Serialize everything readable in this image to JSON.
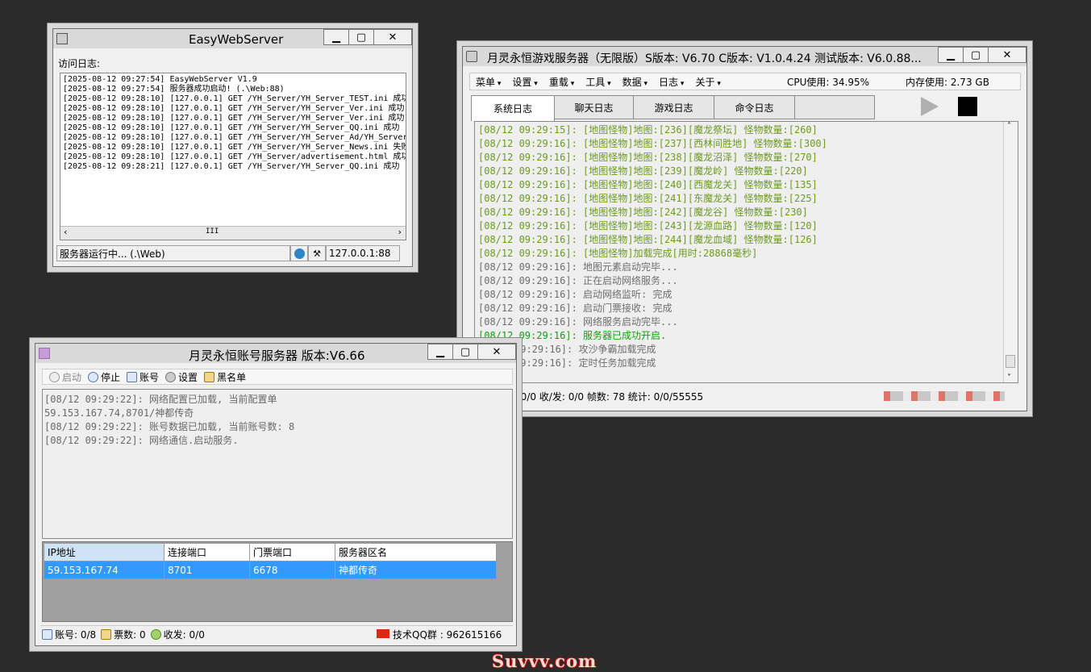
{
  "web": {
    "title": "EasyWebServer",
    "log_label": "访问日志:",
    "log": [
      "[2025-08-12 09:27:54] EasyWebServer V1.9",
      "[2025-08-12 09:27:54] 服务器成功启动! (.\\Web:88)",
      "[2025-08-12 09:28:10] [127.0.0.1] GET /YH_Server/YH_Server_TEST.ini 成功",
      "[2025-08-12 09:28:10] [127.0.0.1] GET /YH_Server/YH_Server_Ver.ini 成功",
      "[2025-08-12 09:28:10] [127.0.0.1] GET /YH_Server/YH_Server_Ver.ini 成功",
      "[2025-08-12 09:28:10] [127.0.0.1] GET /YH_Server/YH_Server_QQ.ini 成功",
      "[2025-08-12 09:28:10] [127.0.0.1] GET /YH_Server/YH_Server_Ad/YH_Server_",
      "[2025-08-12 09:28:10] [127.0.0.1] GET /YH_Server/YH_Server_News.ini 失败",
      "[2025-08-12 09:28:10] [127.0.0.1] GET /YH_Server/advertisement.html 成功",
      "[2025-08-12 09:28:21] [127.0.0.1] GET /YH_Server/YH_Server_QQ.ini 成功"
    ],
    "status": "服务器运行中... (.\\Web)",
    "address": "127.0.0.1:88",
    "scroll_mark": "III"
  },
  "game": {
    "title": "月灵永恒游戏服务器（无限版）S版本: V6.70 C版本: V1.0.4.24 测试版本: V6.0.88...",
    "menus": [
      "菜单",
      "设置",
      "重载",
      "工具",
      "数据",
      "日志",
      "关于"
    ],
    "cpu": "CPU使用: 34.95%",
    "mem": "内存使用: 2.73 GB",
    "tabs": [
      "系统日志",
      "聊天日志",
      "游戏日志",
      "命令日志"
    ],
    "log": [
      {
        "text": "[08/12 09:29:15]: [地图怪物]地图:[236][魔龙祭坛] 怪物数量:[260]",
        "color": "#6c9a22"
      },
      {
        "text": "[08/12 09:29:16]: [地图怪物]地图:[237][西林间胜地] 怪物数量:[300]",
        "color": "#6c9a22"
      },
      {
        "text": "[08/12 09:29:16]: [地图怪物]地图:[238][魔龙沼泽] 怪物数量:[270]",
        "color": "#6c9a22"
      },
      {
        "text": "[08/12 09:29:16]: [地图怪物]地图:[239][魔龙岭] 怪物数量:[220]",
        "color": "#6c9a22"
      },
      {
        "text": "[08/12 09:29:16]: [地图怪物]地图:[240][西魔龙关] 怪物数量:[135]",
        "color": "#6c9a22"
      },
      {
        "text": "[08/12 09:29:16]: [地图怪物]地图:[241][东魔龙关] 怪物数量:[225]",
        "color": "#6c9a22"
      },
      {
        "text": "[08/12 09:29:16]: [地图怪物]地图:[242][魔龙谷] 怪物数量:[230]",
        "color": "#6c9a22"
      },
      {
        "text": "[08/12 09:29:16]: [地图怪物]地图:[243][龙源血路] 怪物数量:[120]",
        "color": "#6c9a22"
      },
      {
        "text": "[08/12 09:29:16]: [地图怪物]地图:[244][魔龙血域] 怪物数量:[126]",
        "color": "#6c9a22"
      },
      {
        "text": "[08/12 09:29:16]: [地图怪物]加载完成[用时:28868毫秒]",
        "color": "#6c9a22"
      },
      {
        "text": "[08/12 09:29:16]: 地图元素启动完毕...",
        "color": "#6e6e6e"
      },
      {
        "text": "[08/12 09:29:16]: 正在启动网络服务...",
        "color": "#6e6e6e"
      },
      {
        "text": "[08/12 09:29:16]: 启动网络监听: 完成",
        "color": "#6e6e6e"
      },
      {
        "text": "[08/12 09:29:16]: 启动门票接收: 完成",
        "color": "#6e6e6e"
      },
      {
        "text": "[08/12 09:29:16]: 网络服务启动完毕...",
        "color": "#6e6e6e"
      },
      {
        "text": "[08/12 09:29:16]: 服务器已成功开启.",
        "color": "#11a011"
      },
      {
        "text": "09:29:16]: 攻沙争霸加载完成",
        "color": "#6e6e6e"
      },
      {
        "text": "09:29:16]: 定时任务加载完成",
        "color": "#6e6e6e"
      }
    ],
    "status": "0/0/0  收/发: 0/0  帧数: 78  统计: 0/0/55555"
  },
  "account": {
    "title": "月灵永恒账号服务器 版本:V6.66",
    "toolbar": [
      "启动",
      "停止",
      "账号",
      "设置",
      "黑名单"
    ],
    "log": [
      "[08/12 09:29:22]: 网络配置已加载, 当前配置单",
      "59.153.167.74,8701/神都传奇",
      "[08/12 09:29:22]: 账号数据已加载, 当前账号数: 8",
      "[08/12 09:29:22]: 网络通信.启动服务."
    ],
    "columns": [
      "IP地址",
      "连接端口",
      "门票端口",
      "服务器区名"
    ],
    "rows": [
      [
        "59.153.167.74",
        "8701",
        "6678",
        "神都传奇"
      ]
    ],
    "status_accounts": "账号: 0/8",
    "status_tickets": "票数: 0",
    "status_io": "收发: 0/0",
    "status_qq": "技术QQ群 : 962615166"
  },
  "watermark": "Suvvv.com"
}
